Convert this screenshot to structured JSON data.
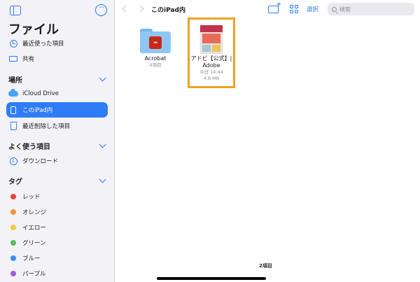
{
  "sidebar": {
    "title": "ファイル",
    "top_items": [
      {
        "label": "最近使った項目",
        "icon": "clock-icon"
      },
      {
        "label": "共有",
        "icon": "shared-folder-icon"
      }
    ],
    "locations": {
      "header": "場所",
      "items": [
        {
          "label": "iCloud Drive",
          "icon": "icloud-icon"
        },
        {
          "label": "このiPad内",
          "icon": "ipad-icon",
          "selected": true
        },
        {
          "label": "最近削除した項目",
          "icon": "trash-icon"
        }
      ]
    },
    "favorites": {
      "header": "よく使う項目",
      "items": [
        {
          "label": "ダウンロード",
          "icon": "download-icon"
        }
      ]
    },
    "tags": {
      "header": "タグ",
      "items": [
        {
          "label": "レッド",
          "color": "#e5463e"
        },
        {
          "label": "オレンジ",
          "color": "#f0973a"
        },
        {
          "label": "イエロー",
          "color": "#f5c842"
        },
        {
          "label": "グリーン",
          "color": "#58c05a"
        },
        {
          "label": "ブルー",
          "color": "#3b8ff3"
        },
        {
          "label": "パープル",
          "color": "#a35cd6"
        }
      ]
    }
  },
  "toolbar": {
    "title": "このiPad内",
    "select_label": "選択",
    "search_placeholder": "検索"
  },
  "files": [
    {
      "name": "Acrobat",
      "meta": "4項目",
      "type": "folder"
    },
    {
      "name_line1": "アドビ【公式】|",
      "name_line2": "Adobe",
      "date": "今日 14:44",
      "size": "4.8 MB",
      "type": "document"
    }
  ],
  "footer": {
    "count": "2項目"
  },
  "accent": "#2f7cf6",
  "highlight_color": "#f1a026"
}
